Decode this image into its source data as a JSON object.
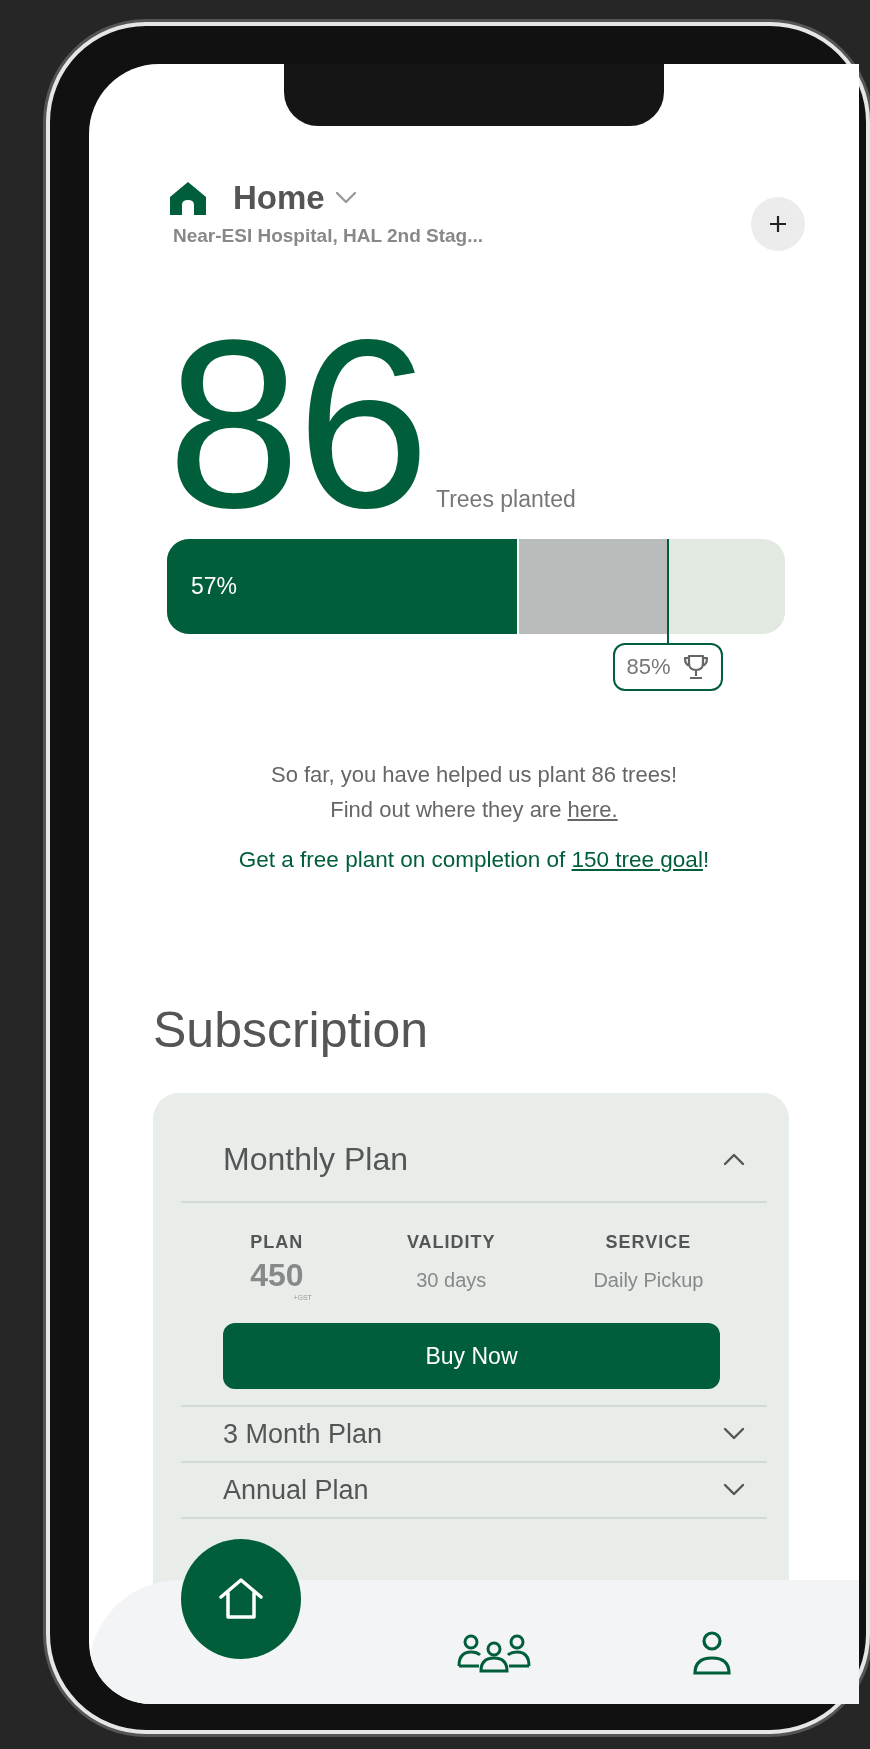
{
  "header": {
    "title": "Home",
    "address": "Near-ESI Hospital, HAL 2nd Stag..."
  },
  "stats": {
    "count": "86",
    "caption": "Trees planted",
    "progress": {
      "label": "57%",
      "level": 0.57
    },
    "target": {
      "label": "85%",
      "level": 0.81
    }
  },
  "message": {
    "text": "So far, you have helped us plant 86 trees!\nFind out where they are ",
    "link": "here."
  },
  "goal": {
    "text": "Get a free plant on completion of ",
    "link": "150 tree goal",
    "suffix": "!"
  },
  "subscription": {
    "title": "Subscription",
    "plans": [
      {
        "name": "Monthly Plan",
        "expanded": true,
        "details": [
          {
            "label": "PLAN",
            "value": "450",
            "note": "+GST"
          },
          {
            "label": "VALIDITY",
            "value": "30 days"
          },
          {
            "label": "SERVICE",
            "value": "Daily Pickup"
          }
        ],
        "action": "Buy Now"
      },
      {
        "name": "3 Month Plan",
        "expanded": false
      },
      {
        "name": "Annual Plan",
        "expanded": false
      }
    ]
  },
  "nav": [
    {
      "kind": "home",
      "selected": true
    },
    {
      "kind": "community",
      "selected": false
    },
    {
      "kind": "profile",
      "selected": false
    }
  ]
}
